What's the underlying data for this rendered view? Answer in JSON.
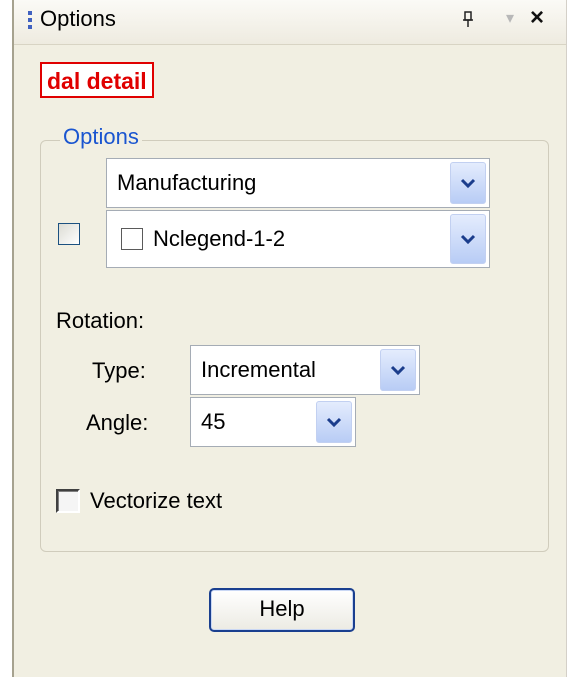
{
  "window": {
    "title": "Options",
    "pin_icon": "pin-icon",
    "dropdown_icon": "chevron-down-icon",
    "close_icon": "close-icon"
  },
  "badge": {
    "label": "dal detail",
    "color": "#e00000"
  },
  "options_group": {
    "legend": "Options",
    "category_select": {
      "value": "Manufacturing"
    },
    "legend_select": {
      "value": "Nclegend-1-2",
      "checked": false
    }
  },
  "rotation": {
    "label": "Rotation:",
    "type": {
      "label": "Type:",
      "value": "Incremental"
    },
    "angle": {
      "label": "Angle:",
      "value": "45"
    }
  },
  "vectorize": {
    "label": "Vectorize text",
    "checked": false
  },
  "help_button": {
    "label": "Help"
  },
  "colors": {
    "accent": "#1a55d0",
    "panel_bg": "#f1efe2"
  }
}
